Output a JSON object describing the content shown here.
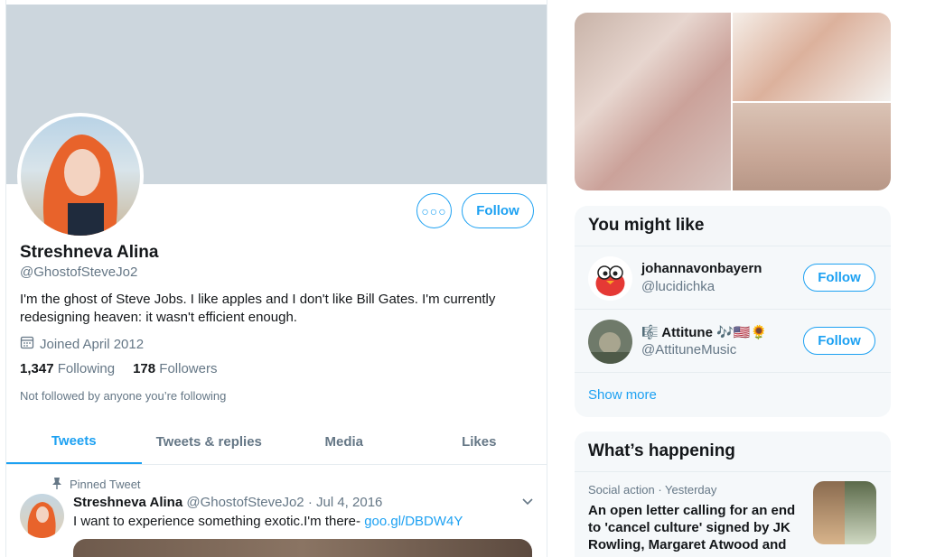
{
  "profile": {
    "name": "Streshneva Alina",
    "handle": "@GhostofSteveJo2",
    "bio": "I'm the ghost of Steve Jobs. I like apples and I don't like Bill Gates. I'm currently redesigning heaven: it wasn't efficient enough.",
    "joined": "Joined April 2012",
    "following_count": "1,347",
    "following_label": "Following",
    "followers_count": "178",
    "followers_label": "Followers",
    "not_followed": "Not followed by anyone you’re following",
    "follow_label": "Follow"
  },
  "tabs": [
    "Tweets",
    "Tweets & replies",
    "Media",
    "Likes"
  ],
  "pinned_tweet": {
    "label": "Pinned Tweet",
    "name": "Streshneva Alina",
    "handle": "@GhostofSteveJo2",
    "date": "· Jul 4, 2016",
    "text": "I want to experience something exotic.I'm there- ",
    "link": "goo.gl/DBDW4Y"
  },
  "you_might_like": {
    "title": "You might like",
    "suggestions": [
      {
        "name": "johannavonbayern",
        "handle": "@lucidichka",
        "button": "Follow"
      },
      {
        "name": "🎼 Attitune 🎶🇺🇸🌻",
        "handle": "@AttituneMusic",
        "button": "Follow"
      }
    ],
    "show_more": "Show more"
  },
  "whats_happening": {
    "title": "What’s happening",
    "trend_meta": "Social action · Yesterday",
    "trend_title": "An open letter calling for an end to 'cancel culture' signed by JK Rowling, Margaret Atwood and"
  },
  "colors": {
    "accent": "#1da1f2",
    "banner": "#ccd6dd",
    "muted": "#657786"
  }
}
